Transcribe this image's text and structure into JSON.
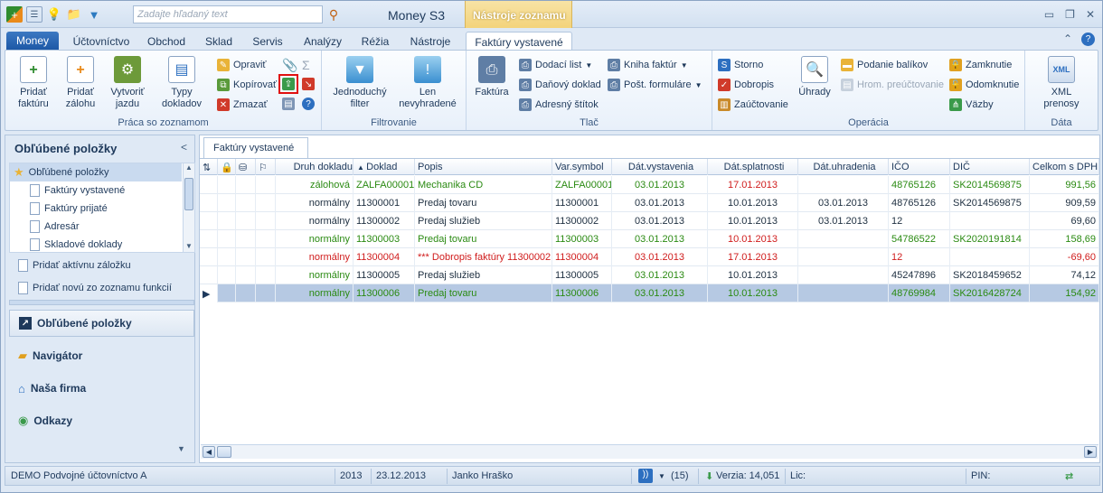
{
  "title": {
    "search_placeholder": "Zadajte hľadaný text",
    "app_name": "Money S3",
    "context_header": "Nástroje zoznamu"
  },
  "tabs": [
    {
      "label": "Money"
    },
    {
      "label": "Účtovníctvo"
    },
    {
      "label": "Obchod"
    },
    {
      "label": "Sklad"
    },
    {
      "label": "Servis"
    },
    {
      "label": "Analýzy"
    },
    {
      "label": "Réžia"
    },
    {
      "label": "Nástroje"
    },
    {
      "label": "Faktúry vystavené"
    }
  ],
  "ribbon": {
    "praca": {
      "label": "Práca so zoznamom",
      "pridat_fakturu": "Pridať\nfaktúru",
      "pridat_zalohu": "Pridať\nzálohu",
      "vytvorit_jazdu": "Vytvoriť\njazdu",
      "typy_dokladov": "Typy\ndokladov",
      "opravit": "Opraviť",
      "kopirovat": "Kopírovať",
      "zmazat": "Zmazať"
    },
    "filtrovanie": {
      "label": "Filtrovanie",
      "jednoduchy": "Jednoduchý\nfilter",
      "nevybavene": "Len\nnevyhradené"
    },
    "tlac": {
      "label": "Tlač",
      "faktura": "Faktúra",
      "dodaci_list": "Dodací list",
      "danovy_doklad": "Daňový doklad",
      "adresny_stitok": "Adresný štítok",
      "kniha_faktur": "Kniha faktúr",
      "post_formulare": "Pošt. formuláre"
    },
    "operacia": {
      "label": "Operácia",
      "storno": "Storno",
      "dobropis": "Dobropis",
      "zauctovanie": "Zaúčtovanie",
      "uhrady": "Úhrady",
      "podanie_balikov": "Podanie balíkov",
      "hrom_preuctovanie": "Hrom. preúčtovanie",
      "zamknutie": "Zamknutie",
      "odomknutie": "Odomknutie",
      "vazby": "Väzby"
    },
    "data": {
      "label": "Dáta",
      "xml_prenosy": "XML\nprenosy"
    }
  },
  "left_panel": {
    "header": "Obľúbené položky",
    "tree": [
      {
        "label": "Obľúbené položky"
      },
      {
        "label": "Faktúry vystavené"
      },
      {
        "label": "Faktúry prijaté"
      },
      {
        "label": "Adresár"
      },
      {
        "label": "Skladové doklady"
      }
    ],
    "add_active": "Pridať aktívnu záložku",
    "add_new": "Pridať novú zo zoznamu funkcií",
    "nav": [
      {
        "label": "Obľúbené položky"
      },
      {
        "label": "Navigátor"
      },
      {
        "label": "Naša firma"
      },
      {
        "label": "Odkazy"
      }
    ]
  },
  "grid": {
    "tab": "Faktúry vystavené",
    "columns": [
      "Druh dokladu",
      "Doklad",
      "Popis",
      "Var.symbol",
      "Dát.vystavenia",
      "Dát.splatnosti",
      "Dát.uhradenia",
      "IČO",
      "DIČ",
      "Celkom s DPH"
    ],
    "rows": [
      {
        "druh": "zálohová",
        "doklad": "ZALFA00001",
        "popis": "Mechanika CD",
        "var": "ZALFA00001",
        "vyst": "03.01.2013",
        "splat": "17.01.2013",
        "uhr": "",
        "ico": "48765126",
        "dic": "SK2014569875",
        "celkom": "991,56"
      },
      {
        "druh": "normálny",
        "doklad": "11300001",
        "popis": "Predaj tovaru",
        "var": "11300001",
        "vyst": "03.01.2013",
        "splat": "10.01.2013",
        "uhr": "03.01.2013",
        "ico": "48765126",
        "dic": "SK2014569875",
        "celkom": "909,59"
      },
      {
        "druh": "normálny",
        "doklad": "11300002",
        "popis": "Predaj služieb",
        "var": "11300002",
        "vyst": "03.01.2013",
        "splat": "10.01.2013",
        "uhr": "03.01.2013",
        "ico": "12",
        "dic": "",
        "celkom": "69,60"
      },
      {
        "druh": "normálny",
        "doklad": "11300003",
        "popis": "Predaj tovaru",
        "var": "11300003",
        "vyst": "03.01.2013",
        "splat": "10.01.2013",
        "uhr": "",
        "ico": "54786522",
        "dic": "SK2020191814",
        "celkom": "158,69"
      },
      {
        "druh": "normálny",
        "doklad": "11300004",
        "popis": "*** Dobropis faktúry 11300002",
        "var": "11300004",
        "vyst": "03.01.2013",
        "splat": "17.01.2013",
        "uhr": "",
        "ico": "12",
        "dic": "",
        "celkom": "-69,60"
      },
      {
        "druh": "normálny",
        "doklad": "11300005",
        "popis": "Predaj služieb",
        "var": "11300005",
        "vyst": "03.01.2013",
        "splat": "10.01.2013",
        "uhr": "",
        "ico": "45247896",
        "dic": "SK2018459652",
        "celkom": "74,12"
      },
      {
        "druh": "normálny",
        "doklad": "11300006",
        "popis": "Predaj tovaru",
        "var": "11300006",
        "vyst": "03.01.2013",
        "splat": "10.01.2013",
        "uhr": "",
        "ico": "48769984",
        "dic": "SK2016428724",
        "celkom": "154,92"
      }
    ]
  },
  "status": {
    "company": "DEMO Podvojné účtovníctvo A",
    "year": "2013",
    "date": "23.12.2013",
    "user": "Janko Hraško",
    "count": "(15)",
    "version": "Verzia: 14,051",
    "lic": "Lic:",
    "pin": "PIN:"
  }
}
